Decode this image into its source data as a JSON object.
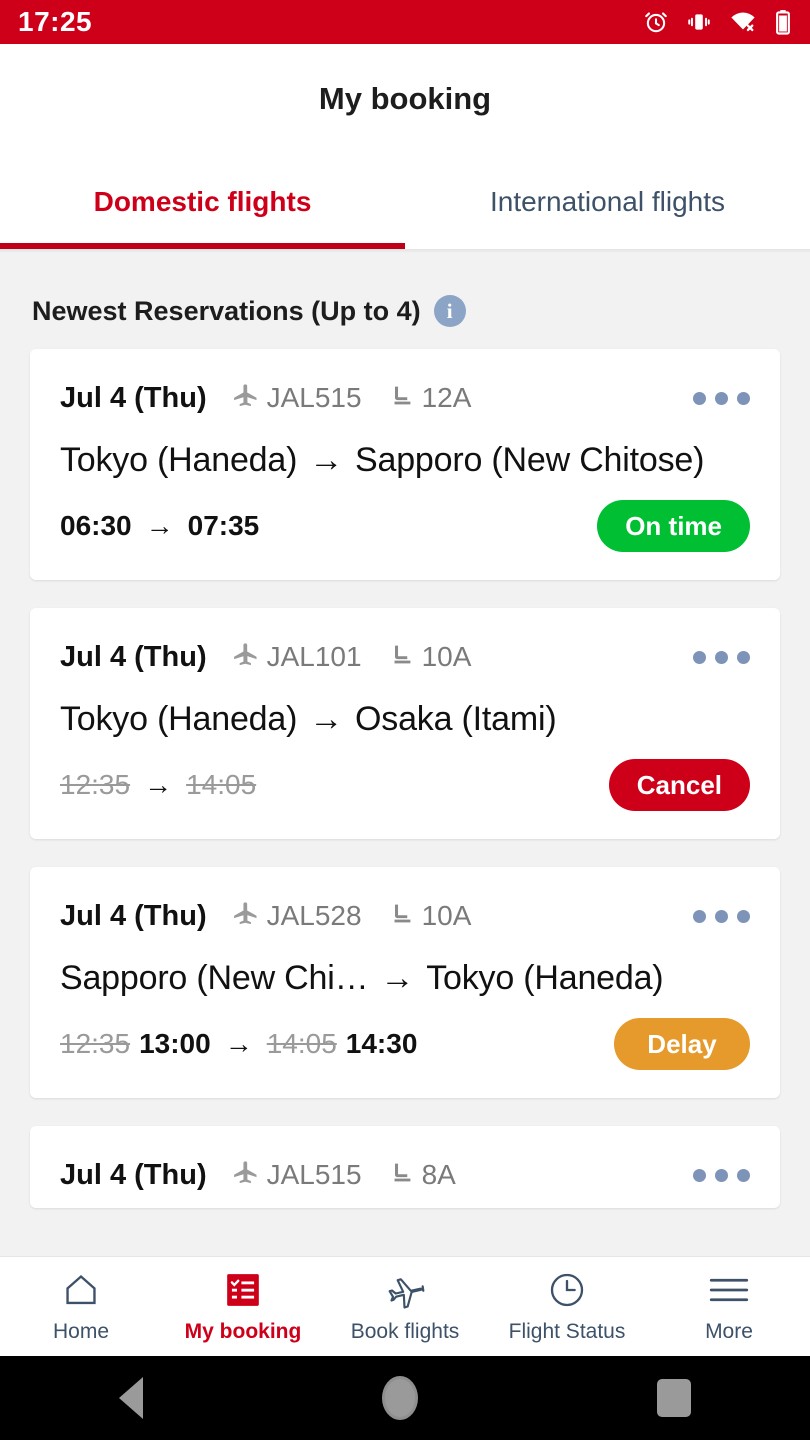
{
  "status_bar": {
    "time": "17:25",
    "icons": [
      "alarm-icon",
      "vibrate-icon",
      "wifi-off-icon",
      "battery-icon"
    ]
  },
  "header": {
    "title": "My booking"
  },
  "tabs": [
    {
      "label": "Domestic flights",
      "active": true
    },
    {
      "label": "International flights",
      "active": false
    }
  ],
  "section": {
    "title": "Newest Reservations (Up to 4)",
    "info_icon_label": "i"
  },
  "reservations": [
    {
      "date": "Jul 4 (Thu)",
      "flight_no": "JAL515",
      "seat": "12A",
      "origin": "Tokyo (Haneda)",
      "arrow": "→",
      "destination": "Sapporo (New Chitose)",
      "dep_time": "06:30",
      "arr_time": "07:35",
      "dep_time_old": "",
      "arr_time_old": "",
      "status_label": "On time",
      "status_color": "#00BF33"
    },
    {
      "date": "Jul 4 (Thu)",
      "flight_no": "JAL101",
      "seat": "10A",
      "origin": "Tokyo (Haneda)",
      "arrow": "→",
      "destination": "Osaka (Itami)",
      "dep_time": "",
      "arr_time": "",
      "dep_time_old": "12:35",
      "arr_time_old": "14:05",
      "status_label": "Cancel",
      "status_color": "#CE0019"
    },
    {
      "date": "Jul 4 (Thu)",
      "flight_no": "JAL528",
      "seat": "10A",
      "origin": "Sapporo (New Chi…",
      "arrow": "→",
      "destination": "Tokyo (Haneda)",
      "dep_time": "13:00",
      "arr_time": "14:30",
      "dep_time_old": "12:35",
      "arr_time_old": "14:05",
      "status_label": "Delay",
      "status_color": "#E59A2B"
    },
    {
      "date": "Jul 4 (Thu)",
      "flight_no": "JAL515",
      "seat": "8A",
      "origin": "",
      "arrow": "",
      "destination": "",
      "dep_time": "",
      "arr_time": "",
      "dep_time_old": "",
      "arr_time_old": "",
      "status_label": "",
      "status_color": ""
    }
  ],
  "bottom_nav": [
    {
      "label": "Home",
      "icon": "home-icon",
      "active": false
    },
    {
      "label": "My booking",
      "icon": "checklist-icon",
      "active": true
    },
    {
      "label": "Book flights",
      "icon": "airplane-icon",
      "active": false
    },
    {
      "label": "Flight Status",
      "icon": "clock-icon",
      "active": false
    },
    {
      "label": "More",
      "icon": "hamburger-icon",
      "active": false
    }
  ],
  "android_nav": [
    "back-button",
    "home-button",
    "recents-button"
  ],
  "colors": {
    "brand_red": "#CE0019",
    "on_time_green": "#00BF33",
    "delay_orange": "#E59A2B",
    "nav_blue": "#3D5169",
    "page_bg": "#F2F2F2"
  }
}
